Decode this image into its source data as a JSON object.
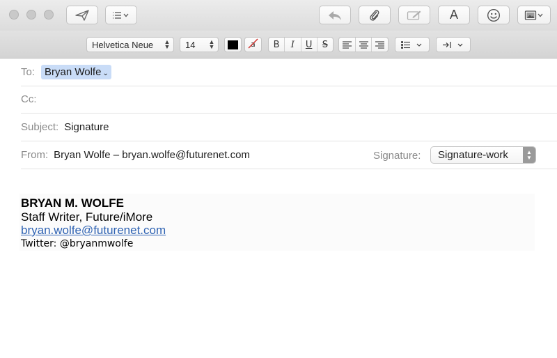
{
  "toolbar": {
    "buttons": [
      {
        "name": "send-button",
        "icon": "paper-plane-icon"
      },
      {
        "name": "header-fields-button",
        "icon": "list-chevron-icon"
      },
      {
        "name": "reply-button",
        "icon": "reply-arrow-icon",
        "disabled": true
      },
      {
        "name": "attach-button",
        "icon": "paperclip-icon"
      },
      {
        "name": "markup-button",
        "icon": "markup-pen-icon",
        "disabled": true
      },
      {
        "name": "fonts-button",
        "icon": "letter-a-icon",
        "glyph": "A"
      },
      {
        "name": "emoji-button",
        "icon": "smiley-icon"
      },
      {
        "name": "photo-browser-button",
        "icon": "photo-chevron-icon"
      }
    ]
  },
  "formatbar": {
    "font_family": "Helvetica Neue",
    "font_size": "14",
    "text_color": "#000000",
    "bold": "B",
    "italic": "I",
    "underline": "U",
    "strikethrough": "S"
  },
  "header": {
    "to_label": "To:",
    "to_token": "Bryan Wolfe",
    "cc_label": "Cc:",
    "subject_label": "Subject:",
    "subject_value": "Signature",
    "from_label": "From:",
    "from_value": "Bryan Wolfe – bryan.wolfe@futurenet.com",
    "signature_label": "Signature:",
    "signature_value": "Signature-work"
  },
  "body": {
    "sig_name": "BRYAN M. WOLFE",
    "sig_title": "Staff Writer, Future/iMore",
    "sig_email": "bryan.wolfe@futurenet.com",
    "sig_twitter": "Twitter: @bryanmwolfe"
  },
  "colors": {
    "token_bg": "#c9dcf7",
    "link": "#2f63b3"
  }
}
